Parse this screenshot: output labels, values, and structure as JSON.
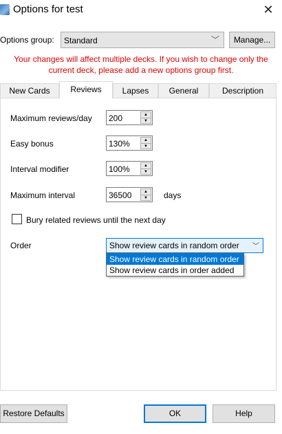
{
  "window": {
    "title": "Options for test",
    "close_glyph": "✕",
    "icon": "app-icon"
  },
  "options_group": {
    "label": "Options group:",
    "value": "Standard",
    "manage_label": "Manage..."
  },
  "warning": {
    "line1": "Your changes will affect multiple decks. If you wish to change only the",
    "line2": "current deck, please add a new options group first.",
    "color": "#e00000"
  },
  "tabs": [
    {
      "label": "New Cards",
      "active": false
    },
    {
      "label": "Reviews",
      "active": true
    },
    {
      "label": "Lapses",
      "active": false
    },
    {
      "label": "General",
      "active": false
    },
    {
      "label": "Description",
      "active": false
    }
  ],
  "reviews": {
    "max_reviews": {
      "label": "Maximum reviews/day",
      "value": "200"
    },
    "easy_bonus": {
      "label": "Easy bonus",
      "value": "130%"
    },
    "interval_modifier": {
      "label": "Interval modifier",
      "value": "100%"
    },
    "max_interval": {
      "label": "Maximum interval",
      "value": "36500",
      "unit": "days"
    },
    "bury": {
      "label": "Bury related reviews until the next day",
      "checked": false
    },
    "order": {
      "label": "Order",
      "selected": "Show review cards in random order",
      "options": [
        "Show review cards in random order",
        "Show review cards in order added"
      ]
    }
  },
  "buttons": {
    "restore": "Restore Defaults",
    "ok": "OK",
    "help": "Help"
  },
  "colors": {
    "accent": "#0078d7"
  }
}
